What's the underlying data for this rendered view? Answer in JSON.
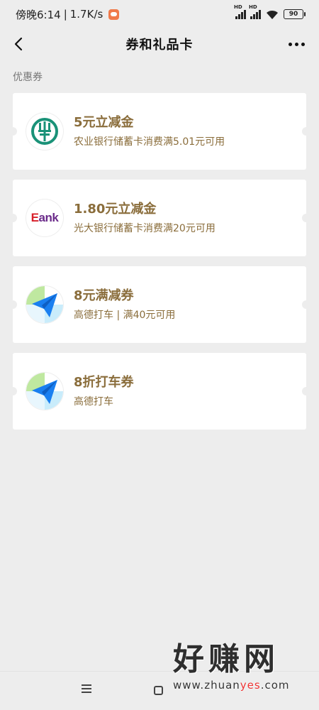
{
  "status_bar": {
    "time": "傍晚6:14",
    "speed": "1.7K/s",
    "separator": "|",
    "hd1": "HD",
    "hd2": "HD",
    "battery": "90"
  },
  "header": {
    "title": "券和礼品卡"
  },
  "section_label": "优惠券",
  "coupons": [
    {
      "title": "5元立减金",
      "desc": "农业银行储蓄卡消费满5.01元可用",
      "icon": "abc-bank-logo-icon"
    },
    {
      "title": "1.80元立减金",
      "desc": "光大银行储蓄卡消费满20元可用",
      "icon": "ebank-logo-icon"
    },
    {
      "title": "8元满减券",
      "desc": "高德打车 | 满40元可用",
      "icon": "amap-logo-icon"
    },
    {
      "title": "8折打车券",
      "desc": "高德打车",
      "icon": "amap-logo-icon"
    }
  ],
  "ebank_logo_text": {
    "e": "E",
    "rest": "ank"
  },
  "watermark": {
    "main": "好赚网",
    "url_prefix": "www.zhuan",
    "url_accent": "yes",
    "url_suffix": ".com"
  },
  "colors": {
    "coupon_text": "#8a6d3b",
    "background": "#ededed",
    "abc_green": "#1a9278",
    "amap_blue": "#1a7ff0"
  }
}
